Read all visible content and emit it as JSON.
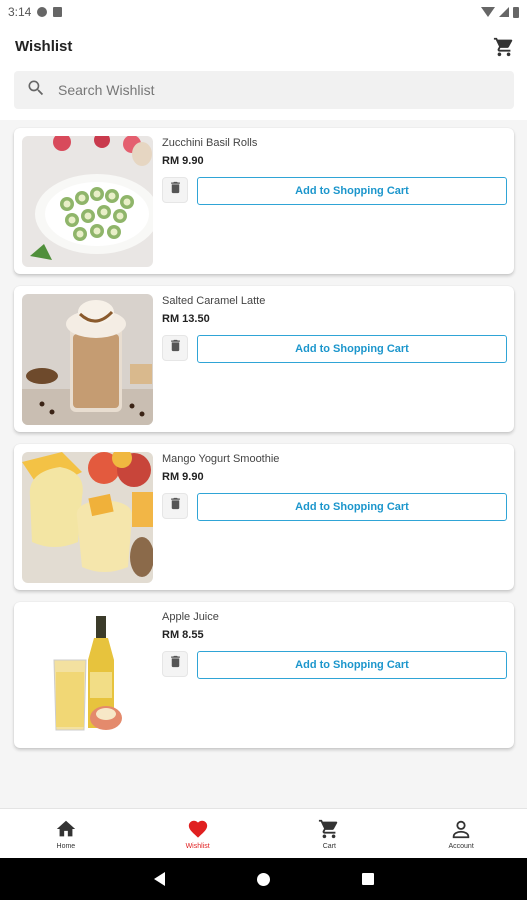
{
  "status_bar": {
    "time": "3:14"
  },
  "header": {
    "title": "Wishlist",
    "search_placeholder": "Search Wishlist"
  },
  "items": [
    {
      "name": "Zucchini Basil Rolls",
      "price": "RM 9.90",
      "add_label": "Add to Shopping Cart"
    },
    {
      "name": "Salted Caramel Latte",
      "price": "RM 13.50",
      "add_label": "Add to Shopping Cart"
    },
    {
      "name": "Mango Yogurt Smoothie",
      "price": "RM 9.90",
      "add_label": "Add to Shopping Cart"
    },
    {
      "name": "Apple Juice",
      "price": "RM 8.55",
      "add_label": "Add to Shopping Cart"
    }
  ],
  "bottom_nav": [
    {
      "label": "Home",
      "icon": "home-icon"
    },
    {
      "label": "Wishlist",
      "icon": "heart-icon",
      "active": true
    },
    {
      "label": "Cart",
      "icon": "cart-icon"
    },
    {
      "label": "Account",
      "icon": "account-icon"
    }
  ],
  "colors": {
    "accent": "#1c96cc",
    "active_nav": "#e02020",
    "background": "#f5f5f5"
  }
}
